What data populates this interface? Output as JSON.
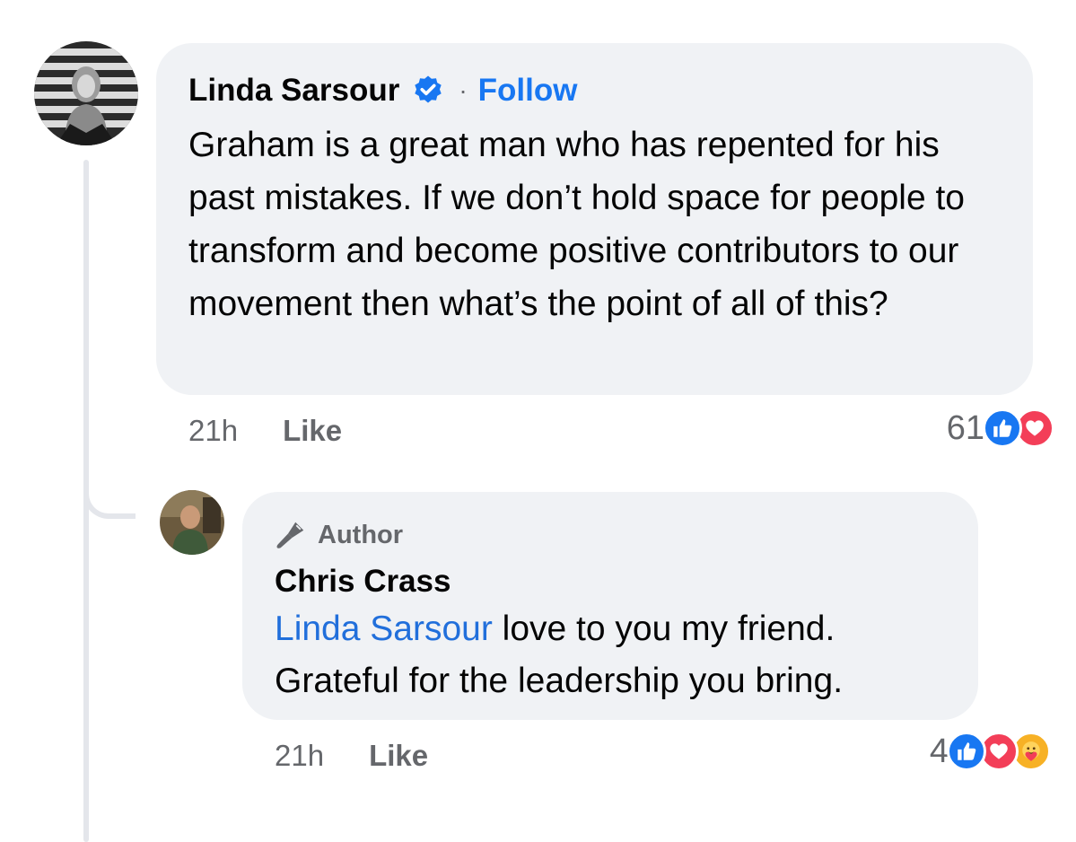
{
  "comment": {
    "author": "Linda Sarsour",
    "separator": "·",
    "follow_label": "Follow",
    "text": "Graham is a great man who has repented for his past mistakes. If we don’t hold space for people to transform and become positive contributors to our movement then what’s the point of all of this?",
    "time": "21h",
    "like_label": "Like",
    "reaction_count": "61",
    "reactions": [
      "like-icon",
      "love-icon"
    ]
  },
  "reply": {
    "badge_label": "Author",
    "author": "Chris Crass",
    "mention": "Linda Sarsour",
    "text": " love to you my friend. Grateful for the leadership you bring.",
    "time": "21h",
    "like_label": "Like",
    "reaction_count": "4",
    "reactions": [
      "like-icon",
      "love-icon",
      "care-icon"
    ]
  },
  "colors": {
    "bubble": "#f0f2f5",
    "accent": "#1877f2",
    "secondary_text": "#65676b",
    "love": "#f33e58",
    "care": "#f7b125"
  }
}
